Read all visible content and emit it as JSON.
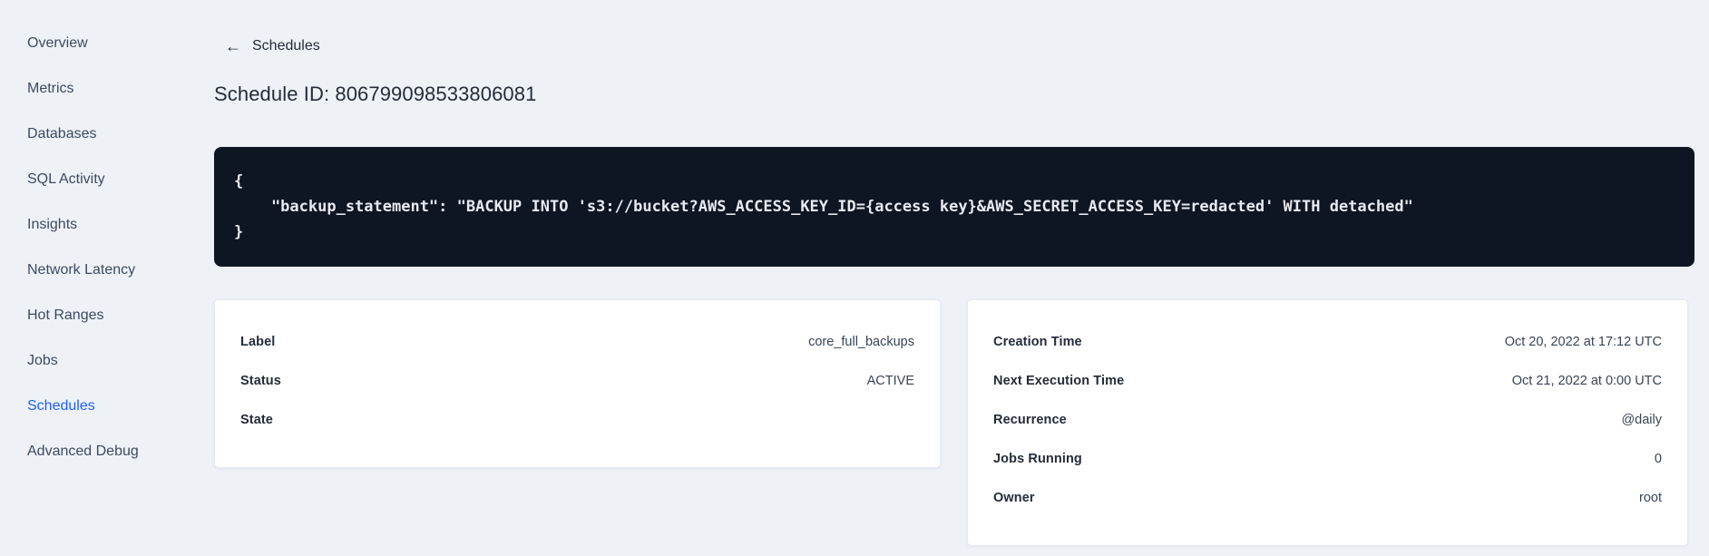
{
  "colors": {
    "page_background": "#eef2f7",
    "active_nav": "#2161f0",
    "code_background": "#0e1523",
    "code_text": "#e7eaf1",
    "heading_text": "#242c3a",
    "value_text": "#394455"
  },
  "icons": {
    "back_arrow": "←"
  },
  "sidebar": {
    "items": [
      {
        "label": "Overview",
        "active": false
      },
      {
        "label": "Metrics",
        "active": false
      },
      {
        "label": "Databases",
        "active": false
      },
      {
        "label": "SQL Activity",
        "active": false
      },
      {
        "label": "Insights",
        "active": false
      },
      {
        "label": "Network Latency",
        "active": false
      },
      {
        "label": "Hot Ranges",
        "active": false
      },
      {
        "label": "Jobs",
        "active": false
      },
      {
        "label": "Schedules",
        "active": true
      },
      {
        "label": "Advanced Debug",
        "active": false
      }
    ]
  },
  "main": {
    "back_label": "Schedules",
    "title": "Schedule ID: 806799098533806081",
    "code": "{\n    \"backup_statement\": \"BACKUP INTO 's3://bucket?AWS_ACCESS_KEY_ID={access key}&AWS_SECRET_ACCESS_KEY=redacted' WITH detached\"\n}",
    "schedule_card": {
      "rows": [
        {
          "label": "Label",
          "value": "core_full_backups"
        },
        {
          "label": "Status",
          "value": "ACTIVE"
        },
        {
          "label": "State",
          "value": ""
        }
      ]
    },
    "timing_card": {
      "rows": [
        {
          "label": "Creation Time",
          "value": "Oct 20, 2022 at 17:12 UTC"
        },
        {
          "label": "Next Execution Time",
          "value": "Oct 21, 2022 at 0:00 UTC"
        },
        {
          "label": "Recurrence",
          "value": "@daily"
        },
        {
          "label": "Jobs Running",
          "value": "0"
        },
        {
          "label": "Owner",
          "value": "root"
        }
      ]
    }
  }
}
